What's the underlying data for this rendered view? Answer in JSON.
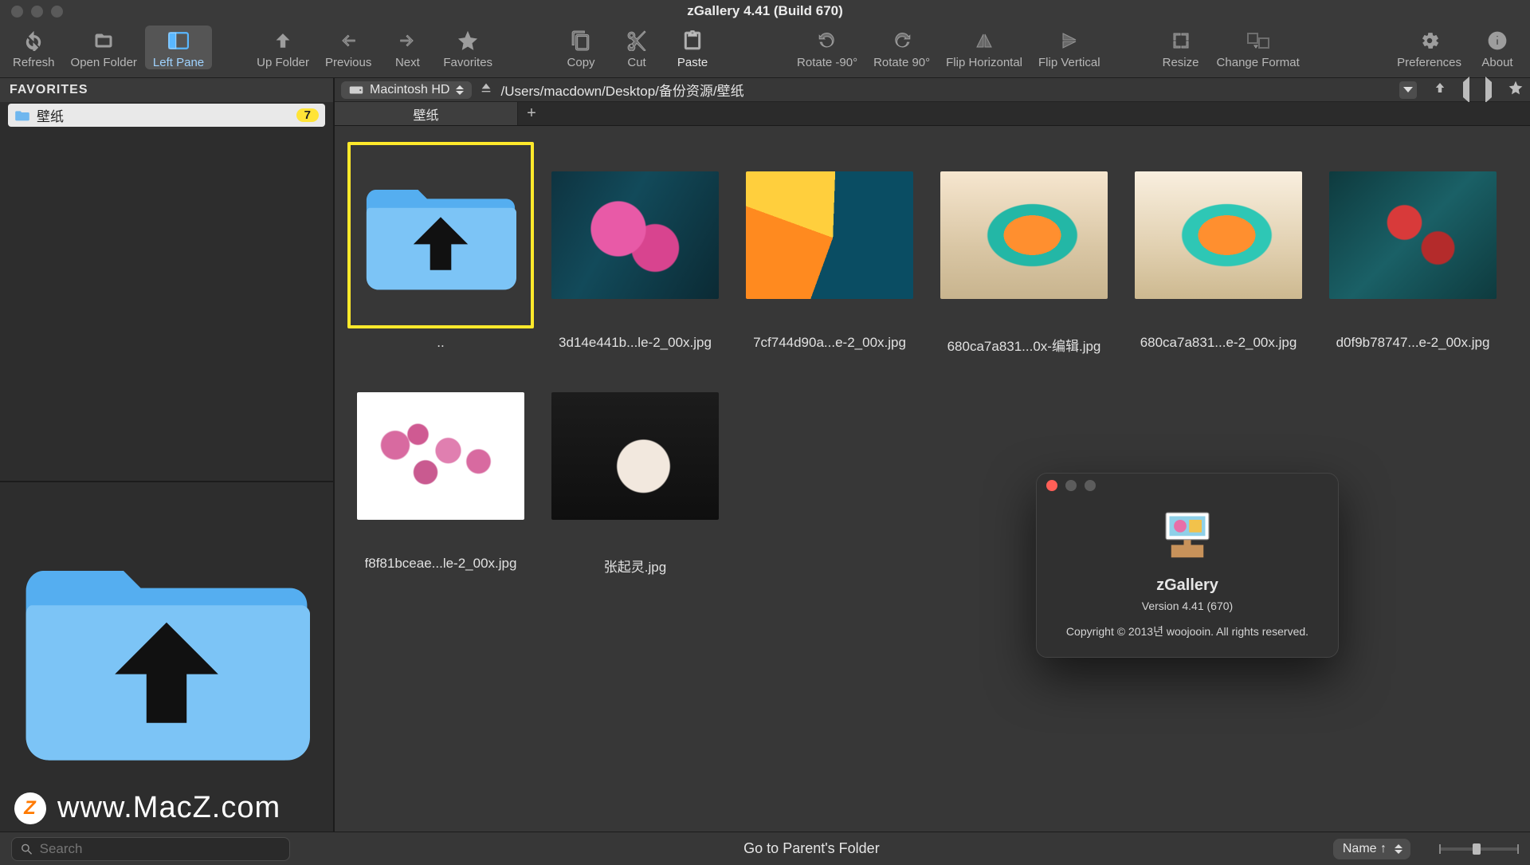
{
  "window": {
    "title": "zGallery 4.41 (Build 670)"
  },
  "toolbar": {
    "refresh": "Refresh",
    "open_folder": "Open Folder",
    "left_pane": "Left Pane",
    "up_folder": "Up Folder",
    "previous": "Previous",
    "next": "Next",
    "favorites": "Favorites",
    "copy": "Copy",
    "cut": "Cut",
    "paste": "Paste",
    "rotate_ccw": "Rotate -90°",
    "rotate_cw": "Rotate 90°",
    "flip_h": "Flip Horizontal",
    "flip_v": "Flip Vertical",
    "resize": "Resize",
    "change_format": "Change Format",
    "preferences": "Preferences",
    "about": "About"
  },
  "location": {
    "volume": "Macintosh HD",
    "path": "/Users/macdown/Desktop/备份资源/壁纸"
  },
  "tabs": {
    "active": "壁纸"
  },
  "sidebar": {
    "favorites_label": "FAVORITES",
    "items": [
      {
        "label": "壁纸",
        "count": "7"
      }
    ]
  },
  "grid": {
    "items": [
      {
        "type": "up",
        "label": ".."
      },
      {
        "type": "img",
        "ph": "ph1",
        "label": "3d14e441b...le-2_00x.jpg"
      },
      {
        "type": "img",
        "ph": "ph2",
        "label": "7cf744d90a...e-2_00x.jpg"
      },
      {
        "type": "img",
        "ph": "ph3",
        "label": "680ca7a831...0x-编辑.jpg"
      },
      {
        "type": "img",
        "ph": "ph4",
        "label": "680ca7a831...e-2_00x.jpg"
      },
      {
        "type": "img",
        "ph": "ph5",
        "label": "d0f9b78747...e-2_00x.jpg"
      },
      {
        "type": "img",
        "ph": "ph6",
        "label": "f8f81bceae...le-2_00x.jpg"
      },
      {
        "type": "img",
        "ph": "ph7",
        "label": "张起灵.jpg"
      }
    ]
  },
  "about": {
    "name": "zGallery",
    "version": "Version 4.41 (670)",
    "copyright": "Copyright © 2013년 woojooin. All rights reserved."
  },
  "status": {
    "search_placeholder": "Search",
    "center": "Go to Parent's Folder",
    "sort": "Name ↑"
  },
  "watermark": {
    "text": "www.MacZ.com",
    "badge": "Z"
  }
}
